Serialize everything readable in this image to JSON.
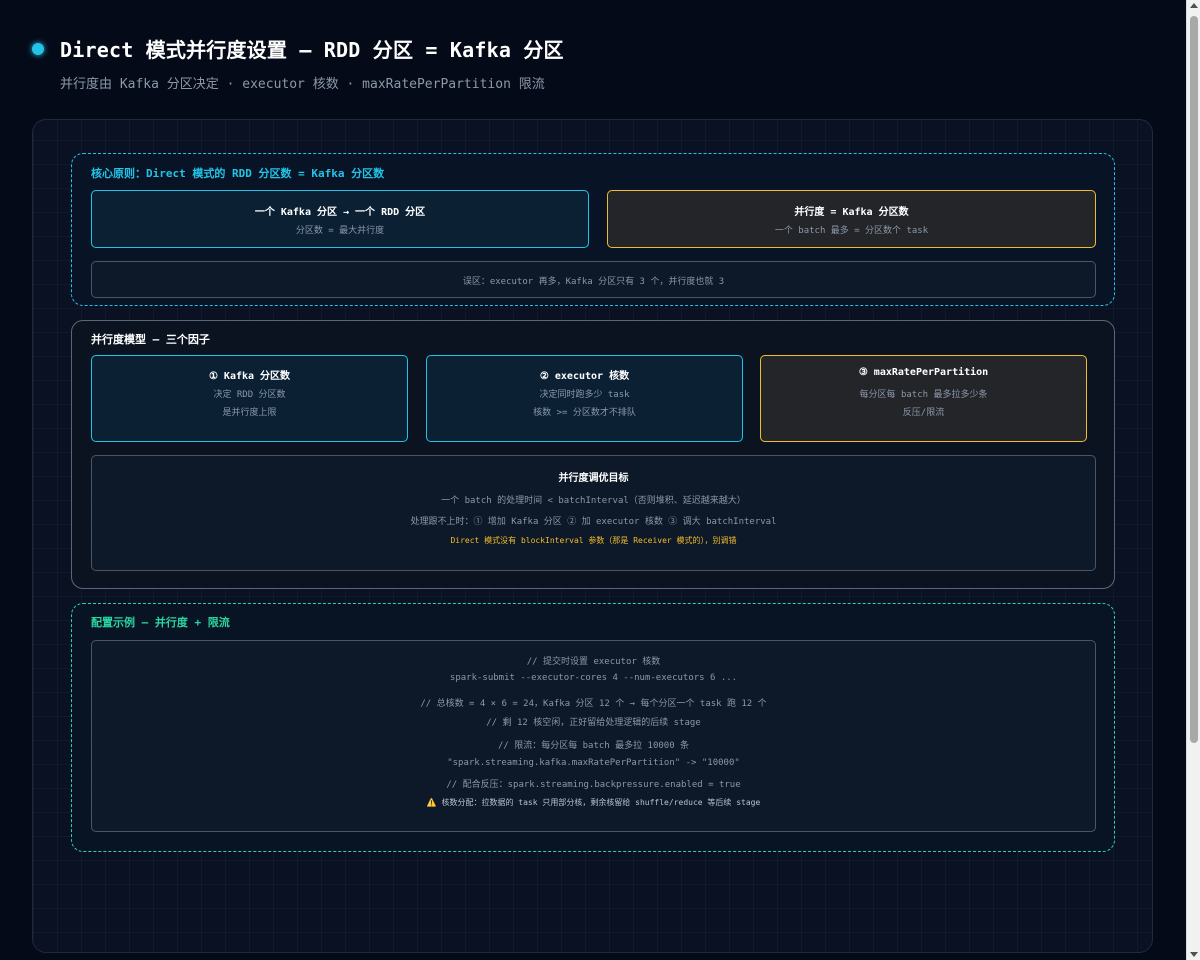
{
  "header": {
    "title": "Direct 模式并行度设置 — RDD 分区 = Kafka 分区",
    "subtitle": "并行度由 Kafka 分区决定 · executor 核数 · maxRatePerPartition 限流"
  },
  "principle": {
    "title": "核心原则：Direct 模式的 RDD 分区数 = Kafka 分区数",
    "box1": {
      "heading": "一个 Kafka 分区 → 一个 RDD 分区",
      "text": "分区数 = 最大并行度"
    },
    "box2": {
      "heading": "并行度 = Kafka 分区数",
      "text": "一个 batch 最多 = 分区数个 task"
    },
    "misconception": "误区：executor 再多，Kafka 分区只有 3 个，并行度也就 3"
  },
  "model": {
    "title": "并行度模型 — 三个因子",
    "factors": [
      {
        "heading": "① Kafka 分区数",
        "line1": "决定 RDD 分区数",
        "line2": "是并行度上限"
      },
      {
        "heading": "② executor 核数",
        "line1": "决定同时跑多少 task",
        "line2": "核数 >= 分区数才不排队"
      },
      {
        "heading": "③ maxRatePerPartition",
        "line1": "每分区每 batch 最多拉多少条",
        "line2": "反压/限流"
      }
    ],
    "tuning": {
      "heading": "并行度调优目标",
      "line1": "一个 batch 的处理时间 < batchInterval（否则堆积、延迟越来越大）",
      "line2": "处理跟不上时：① 增加 Kafka 分区 ② 加 executor 核数 ③ 调大 batchInterval",
      "note": "Direct 模式没有 blockInterval 参数（那是 Receiver 模式的），别调错"
    }
  },
  "config": {
    "title": "配置示例 — 并行度 + 限流",
    "lines": [
      "// 提交时设置 executor 核数",
      "spark-submit --executor-cores 4 --num-executors 6 ...",
      "// 总核数 = 4 × 6 = 24，Kafka 分区 12 个 → 每个分区一个 task 跑 12 个",
      "// 剩 12 核空闲，正好留给处理逻辑的后续 stage",
      "// 限流：每分区每 batch 最多拉 10000 条",
      "\"spark.streaming.kafka.maxRatePerPartition\" -> \"10000\"",
      "// 配合反压：spark.streaming.backpressure.enabled = true",
      "⚠️ 核数分配：拉数据的 task 只用部分核，剩余核留给 shuffle/reduce 等后续 stage"
    ]
  },
  "colors": {
    "background": "#050a18",
    "cyan": "#22c3e6",
    "yellow": "#f2bd2c",
    "green": "#2bd4a0",
    "gray": "#8b98a9"
  }
}
